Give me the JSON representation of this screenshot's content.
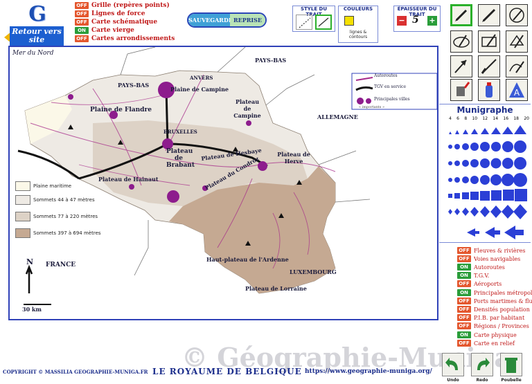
{
  "logo": {
    "letter": "G",
    "retour": "Retour vers site"
  },
  "options": [
    {
      "state": "OFF",
      "label": "Grille (repères points)"
    },
    {
      "state": "OFF",
      "label": "Lignes de force"
    },
    {
      "state": "OFF",
      "label": "Carte schématique"
    },
    {
      "state": "ON",
      "label": "Carte vierge"
    },
    {
      "state": "OFF",
      "label": "Cartes arrondissements"
    }
  ],
  "save": {
    "save_label": "SAUVEGARDE",
    "reset_label": "REPRISE"
  },
  "style_trait": {
    "title": "STYLE DU TRAIT"
  },
  "couleurs": {
    "title": "COULEURS",
    "caption": "lignes & contours"
  },
  "epaisseur": {
    "title": "ÉPAISSEUR DU TRAIT",
    "value": "5",
    "minus": "−",
    "plus": "+"
  },
  "map": {
    "sea": "Mer du Nord",
    "labels": {
      "paysbas1": "PAYS-BAS",
      "paysbas2": "PAYS-BAS",
      "allemagne": "ALLEMAGNE",
      "france": "FRANCE",
      "luxembourg": "LUXEMBOURG",
      "campine": "Plaine de Campine",
      "plateau_campine": "Plateau de Campine",
      "flandre": "Plaine de Flandre",
      "bruxelles": "BRUXELLES",
      "anvers": "ANVERS",
      "plateau_brabant": "Plateau de Brabant",
      "plateau_hesbaye": "Plateau de Hesbaye",
      "plateau_herve": "Plateau de Herve",
      "plateau_hainaut": "Plateau de Hainaut",
      "plateau_condroz": "Plateau du Condroz",
      "haut_ardenne": "Haut-plateau de l'Ardenne",
      "plateau_lorraine": "Plateau de Lorraine",
      "scale": "30 km",
      "north": "N"
    },
    "legend_road": "Autoroutes",
    "legend_tgv": "TGV en service",
    "legend_cities": "Principales villes",
    "legend_cities_note": "« importants »",
    "altitude": [
      {
        "label": "Plaine maritime",
        "color": "#fbf8e8"
      },
      {
        "label": "Sommets 44 à 47 mètres",
        "color": "#eeeae4"
      },
      {
        "label": "Sommets 77 à 220 mètres",
        "color": "#ddd2c6"
      },
      {
        "label": "Sommets 397 à 694 mètres",
        "color": "#c5a992"
      }
    ]
  },
  "munigraphe": {
    "title": "Munigraphe",
    "sizes": [
      "4",
      "6",
      "8",
      "10",
      "12",
      "14",
      "16",
      "18",
      "20"
    ]
  },
  "layers": [
    {
      "state": "OFF",
      "label": "Fleuves & rivières"
    },
    {
      "state": "OFF",
      "label": "Voies navigables"
    },
    {
      "state": "ON",
      "label": "Autoroutes"
    },
    {
      "state": "ON",
      "label": "T.G.V."
    },
    {
      "state": "OFF",
      "label": "Aéroports"
    },
    {
      "state": "ON",
      "label": "Principales métropoles"
    },
    {
      "state": "OFF",
      "label": "Ports martimes & fluviaux"
    },
    {
      "state": "OFF",
      "label": "Densités population"
    },
    {
      "state": "OFF",
      "label": "P.I.B. par habitant"
    },
    {
      "state": "OFF",
      "label": "Régions / Provinces"
    },
    {
      "state": "ON",
      "label": "Carte physique"
    },
    {
      "state": "OFF",
      "label": "Carte en relief"
    }
  ],
  "footer": {
    "copyright": "COPYRIGHT © MASSILIA GEOGRAPHIE-MUNIGA.FR",
    "title": "LE ROYAUME DE BELGIQUE",
    "url": "https://www.geographie-muniga.org/",
    "watermark": "© Géographie-Muniga",
    "undo": "Undo",
    "redo": "Redo",
    "trash": "Poubelle"
  }
}
